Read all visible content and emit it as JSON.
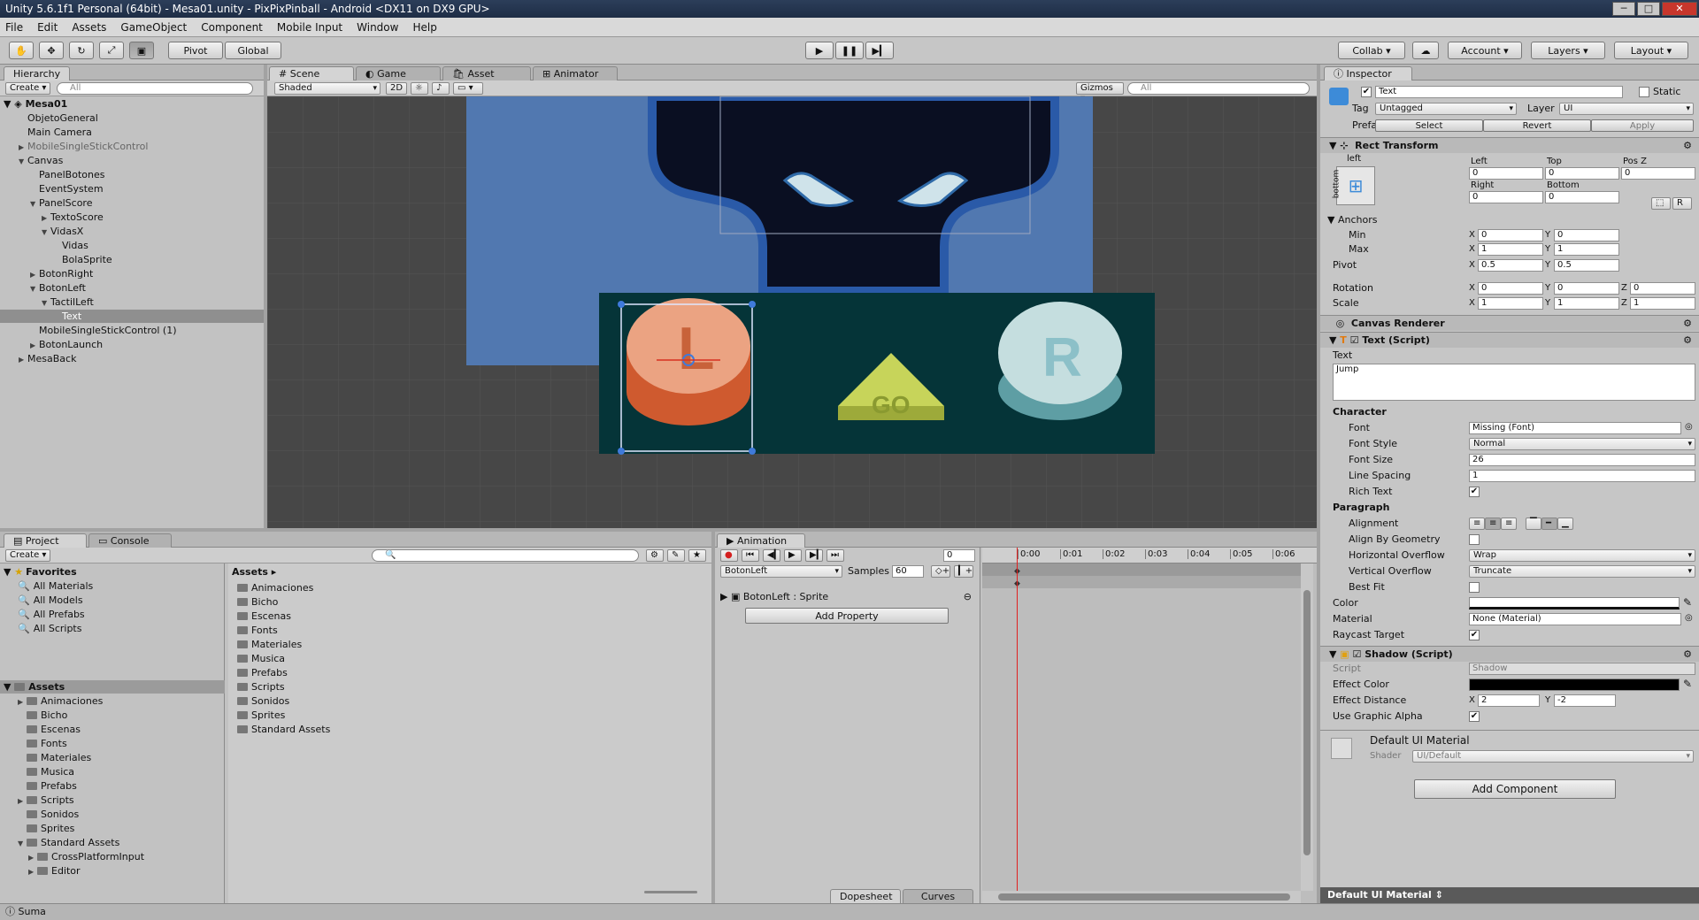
{
  "window": {
    "title": "Unity 5.6.1f1 Personal (64bit) - Mesa01.unity - PixPixPinball - Android <DX11 on DX9 GPU>",
    "minimize": "─",
    "maximize": "□",
    "close": "✕"
  },
  "menu": [
    "File",
    "Edit",
    "Assets",
    "GameObject",
    "Component",
    "Mobile Input",
    "Window",
    "Help"
  ],
  "toolbar": {
    "tools": [
      "hand-icon",
      "move-icon",
      "rotate-icon",
      "scale-icon",
      "rect-icon"
    ],
    "pivot": "Pivot",
    "global": "Global",
    "collab": "Collab",
    "cloud": "☁",
    "account": "Account",
    "layers": "Layers",
    "layout": "Layout"
  },
  "hierarchy": {
    "tab": "Hierarchy",
    "create": "Create",
    "search": "All",
    "scene": "Mesa01",
    "items": [
      {
        "label": "ObjetoGeneral",
        "depth": 1,
        "arrow": ""
      },
      {
        "label": "Main Camera",
        "depth": 1,
        "arrow": ""
      },
      {
        "label": "MobileSingleStickControl",
        "depth": 1,
        "arrow": "▶",
        "dim": true
      },
      {
        "label": "Canvas",
        "depth": 1,
        "arrow": "▼"
      },
      {
        "label": "PanelBotones",
        "depth": 2,
        "arrow": ""
      },
      {
        "label": "EventSystem",
        "depth": 2,
        "arrow": ""
      },
      {
        "label": "PanelScore",
        "depth": 2,
        "arrow": "▼"
      },
      {
        "label": "TextoScore",
        "depth": 3,
        "arrow": "▶"
      },
      {
        "label": "VidasX",
        "depth": 3,
        "arrow": "▼"
      },
      {
        "label": "Vidas",
        "depth": 4,
        "arrow": ""
      },
      {
        "label": "BolaSprite",
        "depth": 4,
        "arrow": ""
      },
      {
        "label": "BotonRight",
        "depth": 2,
        "arrow": "▶"
      },
      {
        "label": "BotonLeft",
        "depth": 2,
        "arrow": "▼"
      },
      {
        "label": "TactilLeft",
        "depth": 3,
        "arrow": "▼"
      },
      {
        "label": "Text",
        "depth": 4,
        "arrow": "",
        "sel": true
      },
      {
        "label": "MobileSingleStickControl (1)",
        "depth": 2,
        "arrow": ""
      },
      {
        "label": "BotonLaunch",
        "depth": 2,
        "arrow": "▶"
      },
      {
        "label": "MesaBack",
        "depth": 1,
        "arrow": "▶"
      }
    ]
  },
  "scene": {
    "tabs": [
      "Scene",
      "Game",
      "Asset Store",
      "Animator"
    ],
    "shaded": "Shaded",
    "mode2d": "2D",
    "gizmos": "Gizmos",
    "search": "All",
    "btn_left": "L",
    "btn_go": "GO",
    "btn_right": "R"
  },
  "project": {
    "tabs": [
      "Project",
      "Console"
    ],
    "create": "Create",
    "favorites_title": "Favorites",
    "favorites": [
      "All Materials",
      "All Models",
      "All Prefabs",
      "All Scripts"
    ],
    "assets_title": "Assets",
    "tree": [
      {
        "label": "Animaciones",
        "d": 1,
        "a": "▶"
      },
      {
        "label": "Bicho",
        "d": 1,
        "a": ""
      },
      {
        "label": "Escenas",
        "d": 1,
        "a": ""
      },
      {
        "label": "Fonts",
        "d": 1,
        "a": ""
      },
      {
        "label": "Materiales",
        "d": 1,
        "a": ""
      },
      {
        "label": "Musica",
        "d": 1,
        "a": ""
      },
      {
        "label": "Prefabs",
        "d": 1,
        "a": ""
      },
      {
        "label": "Scripts",
        "d": 1,
        "a": "▶"
      },
      {
        "label": "Sonidos",
        "d": 1,
        "a": ""
      },
      {
        "label": "Sprites",
        "d": 1,
        "a": ""
      },
      {
        "label": "Standard Assets",
        "d": 1,
        "a": "▼"
      },
      {
        "label": "CrossPlatformInput",
        "d": 2,
        "a": "▶"
      },
      {
        "label": "Editor",
        "d": 2,
        "a": "▶"
      }
    ],
    "breadcrumb": "Assets ▸",
    "folders": [
      "Animaciones",
      "Bicho",
      "Escenas",
      "Fonts",
      "Materiales",
      "Musica",
      "Prefabs",
      "Scripts",
      "Sonidos",
      "Sprites",
      "Standard Assets"
    ]
  },
  "animation": {
    "tab": "Animation",
    "frame": "0",
    "clip": "BotonLeft",
    "samples_label": "Samples",
    "samples": "60",
    "track": "BotonLeft : Sprite",
    "add_property": "Add Property",
    "times": [
      "0:00",
      "0:01",
      "0:02",
      "0:03",
      "0:04",
      "0:05",
      "0:06"
    ],
    "dopesheet": "Dopesheet",
    "curves": "Curves"
  },
  "inspector": {
    "tab": "Inspector",
    "name": "Text",
    "static": "Static",
    "tag_label": "Tag",
    "tag": "Untagged",
    "layer_label": "Layer",
    "layer": "UI",
    "prefab_label": "Prefab",
    "select": "Select",
    "revert": "Revert",
    "apply": "Apply",
    "rect": {
      "title": "Rect Transform",
      "anchor_h": "left",
      "anchor_v": "bottom",
      "left_l": "Left",
      "top_l": "Top",
      "posz_l": "Pos Z",
      "left": "0",
      "top": "0",
      "posz": "0",
      "right_l": "Right",
      "bottom_l": "Bottom",
      "right": "0",
      "bottom": "0",
      "r_btn": "R",
      "anchors": "Anchors",
      "min": "Min",
      "max": "Max",
      "min_x": "0",
      "min_y": "0",
      "max_x": "1",
      "max_y": "1",
      "pivot": "Pivot",
      "pivot_x": "0.5",
      "pivot_y": "0.5",
      "rotation": "Rotation",
      "rot_x": "0",
      "rot_y": "0",
      "rot_z": "0",
      "scale": "Scale",
      "sc_x": "1",
      "sc_y": "1",
      "sc_z": "1",
      "x": "X",
      "y": "Y",
      "z": "Z"
    },
    "canvas_renderer": "Canvas Renderer",
    "text": {
      "title": "Text (Script)",
      "text_label": "Text",
      "text": "Jump",
      "character": "Character",
      "font_l": "Font",
      "font": "Missing (Font)",
      "style_l": "Font Style",
      "style": "Normal",
      "size_l": "Font Size",
      "size": "26",
      "spacing_l": "Line Spacing",
      "spacing": "1",
      "rich_l": "Rich Text",
      "paragraph": "Paragraph",
      "align_l": "Alignment",
      "geom_l": "Align By Geometry",
      "hover_l": "Horizontal Overflow",
      "hover": "Wrap",
      "vover_l": "Vertical Overflow",
      "vover": "Truncate",
      "best_l": "Best Fit",
      "color_l": "Color",
      "material_l": "Material",
      "material": "None (Material)",
      "raycast_l": "Raycast Target"
    },
    "shadow": {
      "title": "Shadow (Script)",
      "script_l": "Script",
      "script": "Shadow",
      "effect_color_l": "Effect Color",
      "dist_l": "Effect Distance",
      "dist_x": "2",
      "dist_y": "-2",
      "alpha_l": "Use Graphic Alpha"
    },
    "material": {
      "title": "Default UI Material",
      "shader_l": "Shader",
      "shader": "UI/Default"
    },
    "add_component": "Add Component",
    "preview": "Default UI Material ⇕"
  },
  "status": "Suma",
  "colors": {
    "scene_bg": "#474747",
    "table_blue": "#5178b0",
    "panel_teal": "#053438",
    "btn_left": "#eba382",
    "btn_left_dark": "#cf5a2f",
    "btn_go": "#c7d45a",
    "btn_right": "#c5dedf",
    "btn_right_dark": "#5e9ea4"
  }
}
